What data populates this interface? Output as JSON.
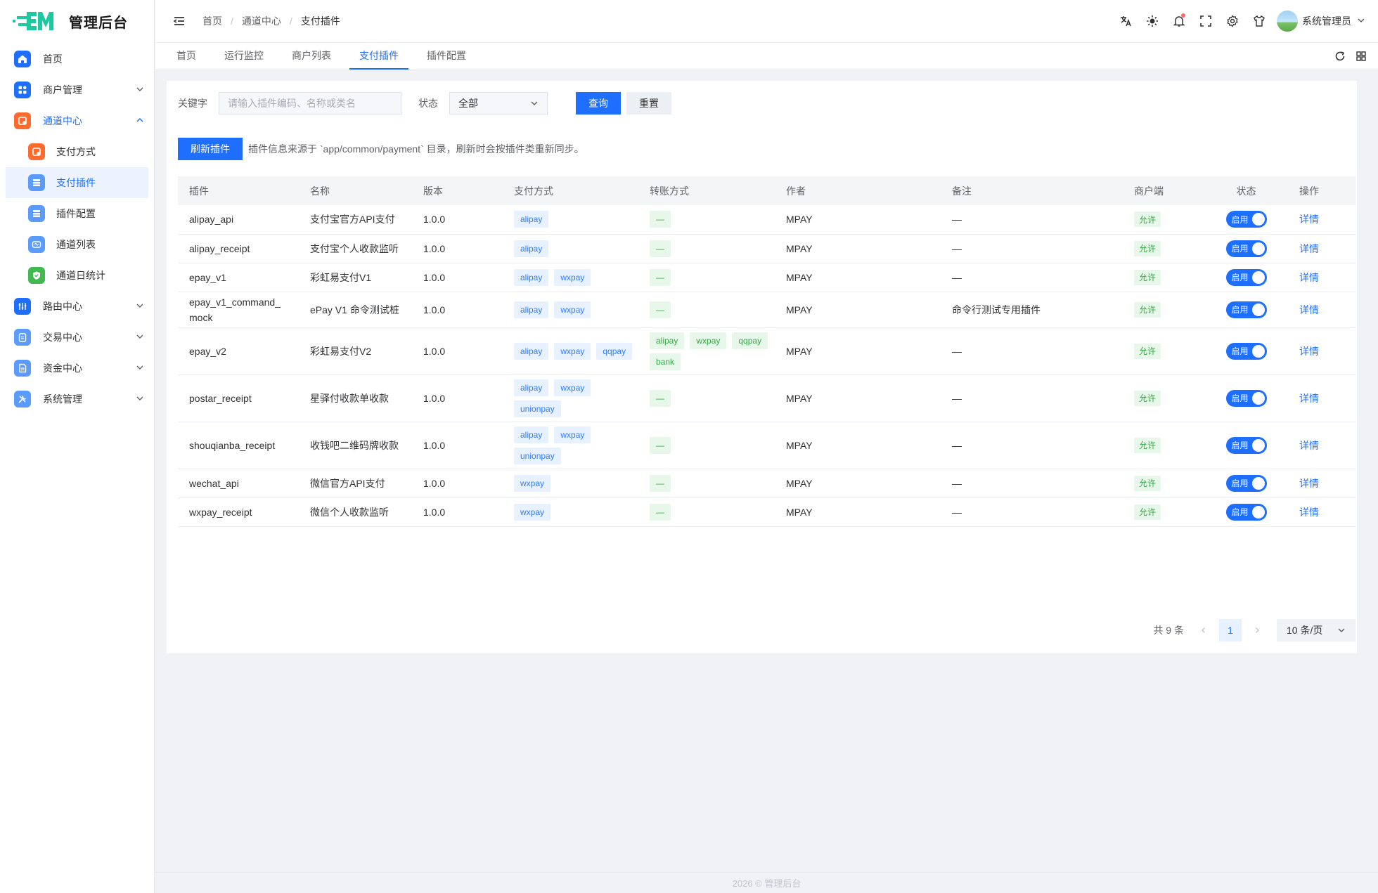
{
  "app": {
    "title": "管理后台"
  },
  "colors": {
    "primary": "#1e6fff",
    "success": "#35a846",
    "sidebar_bg": "#ffffff",
    "page_bg": "#f0f2f5"
  },
  "sidebar": {
    "items": [
      {
        "label": "首页",
        "icon": "home-icon",
        "color": "#1e6fff"
      },
      {
        "label": "商户管理",
        "icon": "apps-icon",
        "color": "#1e6fff"
      },
      {
        "label": "通道中心",
        "icon": "channel-icon",
        "color": "#ff6b2c"
      },
      {
        "label": "路由中心",
        "icon": "sliders-icon",
        "color": "#1e6fff"
      },
      {
        "label": "交易中心",
        "icon": "clipboard-icon",
        "color": "#5b9bff"
      },
      {
        "label": "资金中心",
        "icon": "document-icon",
        "color": "#5b9bff"
      },
      {
        "label": "系统管理",
        "icon": "tools-icon",
        "color": "#5b9bff"
      }
    ],
    "sub_items": [
      {
        "label": "支付方式",
        "icon": "payment-icon",
        "color": "#ff6b2c"
      },
      {
        "label": "支付插件",
        "icon": "plugin-icon",
        "color": "#5b9bff"
      },
      {
        "label": "插件配置",
        "icon": "config-icon",
        "color": "#5b9bff"
      },
      {
        "label": "通道列表",
        "icon": "list-icon",
        "color": "#5b9bff"
      },
      {
        "label": "通道日统计",
        "icon": "shield-icon",
        "color": "#3fb950"
      }
    ]
  },
  "header": {
    "breadcrumb": [
      "首页",
      "通道中心",
      "支付插件"
    ],
    "user_name": "系统管理员"
  },
  "tabs": [
    "首页",
    "运行监控",
    "商户列表",
    "支付插件",
    "插件配置"
  ],
  "filter": {
    "keyword_label": "关键字",
    "keyword_placeholder": "请输入插件编码、名称或类名",
    "status_label": "状态",
    "status_value": "全部",
    "query_button": "查询",
    "reset_button": "重置"
  },
  "refresh": {
    "button": "刷新插件",
    "hint": "插件信息来源于 `app/common/payment` 目录，刷新时会按插件类重新同步。"
  },
  "table": {
    "columns": [
      "插件",
      "名称",
      "版本",
      "支付方式",
      "转账方式",
      "作者",
      "备注",
      "商户端",
      "状态",
      "操作"
    ],
    "rows": [
      {
        "code": "alipay_api",
        "name": "支付宝官方API支付",
        "version": "1.0.0",
        "pay": [
          "alipay"
        ],
        "transfer": [
          "—"
        ],
        "author": "MPAY",
        "remark": "—",
        "merchant": "允许",
        "status": "启用",
        "action": "详情"
      },
      {
        "code": "alipay_receipt",
        "name": "支付宝个人收款监听",
        "version": "1.0.0",
        "pay": [
          "alipay"
        ],
        "transfer": [
          "—"
        ],
        "author": "MPAY",
        "remark": "—",
        "merchant": "允许",
        "status": "启用",
        "action": "详情"
      },
      {
        "code": "epay_v1",
        "name": "彩虹易支付V1",
        "version": "1.0.0",
        "pay": [
          "alipay",
          "wxpay"
        ],
        "transfer": [
          "—"
        ],
        "author": "MPAY",
        "remark": "—",
        "merchant": "允许",
        "status": "启用",
        "action": "详情"
      },
      {
        "code": "epay_v1_command_\nmock",
        "name": "ePay V1 命令测试桩",
        "version": "1.0.0",
        "pay": [
          "alipay",
          "wxpay"
        ],
        "transfer": [
          "—"
        ],
        "author": "MPAY",
        "remark": "命令行测试专用插件",
        "merchant": "允许",
        "status": "启用",
        "action": "详情"
      },
      {
        "code": "epay_v2",
        "name": "彩虹易支付V2",
        "version": "1.0.0",
        "pay": [
          "alipay",
          "wxpay",
          "qqpay"
        ],
        "transfer": [
          "alipay",
          "wxpay",
          "qqpay",
          "bank"
        ],
        "author": "MPAY",
        "remark": "—",
        "merchant": "允许",
        "status": "启用",
        "action": "详情"
      },
      {
        "code": "postar_receipt",
        "name": "星驿付收款单收款",
        "version": "1.0.0",
        "pay": [
          "alipay",
          "wxpay",
          "unionpay"
        ],
        "transfer": [
          "—"
        ],
        "author": "MPAY",
        "remark": "—",
        "merchant": "允许",
        "status": "启用",
        "action": "详情"
      },
      {
        "code": "shouqianba_receipt",
        "name": "收钱吧二维码牌收款",
        "version": "1.0.0",
        "pay": [
          "alipay",
          "wxpay",
          "unionpay"
        ],
        "transfer": [
          "—"
        ],
        "author": "MPAY",
        "remark": "—",
        "merchant": "允许",
        "status": "启用",
        "action": "详情"
      },
      {
        "code": "wechat_api",
        "name": "微信官方API支付",
        "version": "1.0.0",
        "pay": [
          "wxpay"
        ],
        "transfer": [
          "—"
        ],
        "author": "MPAY",
        "remark": "—",
        "merchant": "允许",
        "status": "启用",
        "action": "详情"
      },
      {
        "code": "wxpay_receipt",
        "name": "微信个人收款监听",
        "version": "1.0.0",
        "pay": [
          "wxpay"
        ],
        "transfer": [
          "—"
        ],
        "author": "MPAY",
        "remark": "—",
        "merchant": "允许",
        "status": "启用",
        "action": "详情"
      }
    ]
  },
  "pagination": {
    "total": "共 9 条",
    "current": "1",
    "size": "10 条/页"
  },
  "footer": "2026 © 管理后台"
}
